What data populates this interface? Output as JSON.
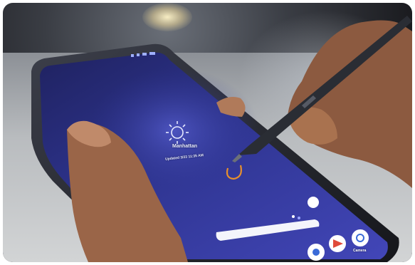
{
  "photo": {
    "subject": "",
    "screen": {
      "location_label": "Manhattan",
      "weather_sub": "Updated 3/23 11:35 AM",
      "temp": "",
      "camera_label": "Camera"
    }
  },
  "colors": {
    "screen_bg_top": "#2a2f7a",
    "screen_bg_bottom": "#3b3fa8",
    "pen_body": "#2b2e35",
    "skin": "#9e6a4c",
    "table": "#c5c7c9"
  }
}
